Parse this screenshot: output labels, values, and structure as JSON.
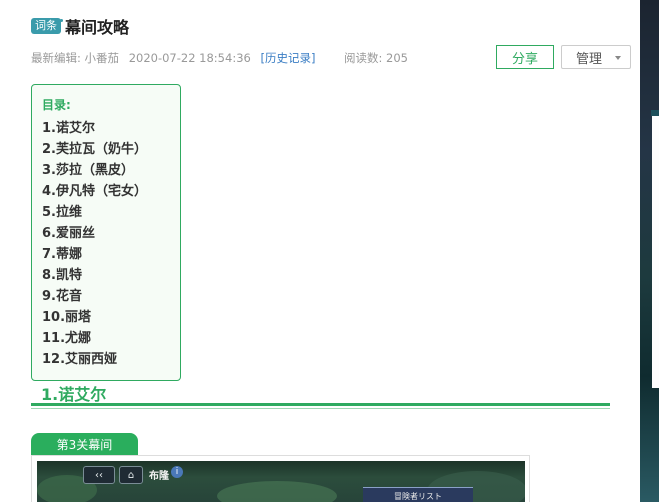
{
  "article": {
    "badge": "词条",
    "title": "幕间攻略"
  },
  "meta": {
    "editor": "最新编辑: 小番茄",
    "time": "2020-07-22 18:54:36",
    "history_link": "[历史记录]",
    "reads": "阅读数: 205"
  },
  "actions": {
    "share": "分享",
    "manage": "管理"
  },
  "toc": {
    "heading": "目录:",
    "items": [
      "1.诺艾尔",
      "2.芙拉瓦（奶牛）",
      "3.莎拉（黑皮）",
      "4.伊凡特（宅女）",
      "5.拉维",
      "6.爱丽丝",
      "7.蒂娜",
      "8.凯特",
      "9.花音",
      "10.丽塔",
      "11.尤娜",
      "12.艾丽西娅"
    ]
  },
  "section": {
    "heading": "1.诺艾尔",
    "tab_label": "第3关幕间"
  },
  "game_screenshot": {
    "back_icon": "back-arrow-icon",
    "home_icon": "home-icon",
    "location": "布隆",
    "info": "i",
    "panel_title": "冒険者リスト"
  }
}
